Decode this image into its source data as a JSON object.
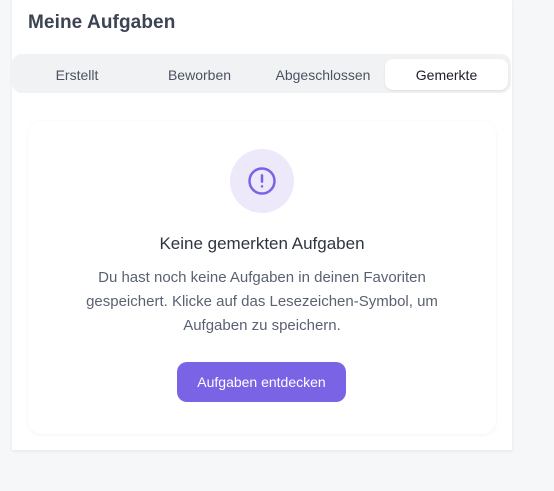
{
  "header": {
    "title": "Meine Aufgaben"
  },
  "tabs": [
    {
      "label": "Erstellt",
      "active": false
    },
    {
      "label": "Beworben",
      "active": false
    },
    {
      "label": "Abgeschlossen",
      "active": false
    },
    {
      "label": "Gemerkte",
      "active": true
    }
  ],
  "empty_state": {
    "icon": "alert-circle-icon",
    "title": "Keine gemerkten Aufgaben",
    "description": "Du hast noch keine Aufgaben in deinen Favoriten gespeichert. Klicke auf das Lesezeichen-Symbol, um Aufgaben zu speichern.",
    "button_label": "Aufgaben entdecken"
  },
  "colors": {
    "accent": "#7b63e6",
    "icon_bg": "#ede9fb",
    "page_bg": "#f6f7f9"
  }
}
